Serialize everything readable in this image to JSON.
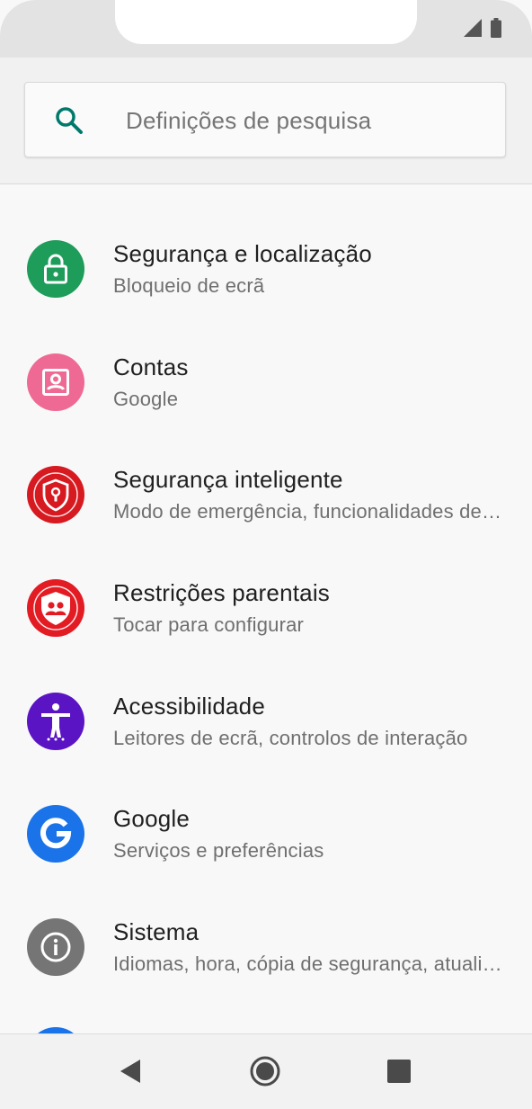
{
  "search": {
    "placeholder": "Definições de pesquisa"
  },
  "settings": [
    {
      "title": "Segurança e localização",
      "subtitle": "Bloqueio de ecrã",
      "icon": "lock-icon",
      "color": "#1e9c5a"
    },
    {
      "title": "Contas",
      "subtitle": "Google",
      "icon": "account-box-icon",
      "color": "#ee6a94"
    },
    {
      "title": "Segurança inteligente",
      "subtitle": "Modo de emergência, funcionalidades de segurança",
      "icon": "shield-keyhole-icon",
      "color": "#d71920"
    },
    {
      "title": "Restrições parentais",
      "subtitle": "Tocar para configurar",
      "icon": "parental-shield-icon",
      "color": "#e31b23"
    },
    {
      "title": "Acessibilidade",
      "subtitle": "Leitores de ecrã, controlos de interação",
      "icon": "accessibility-icon",
      "color": "#5b14c4"
    },
    {
      "title": "Google",
      "subtitle": "Serviços e preferências",
      "icon": "google-g-icon",
      "color": "#1a73e8"
    },
    {
      "title": "Sistema",
      "subtitle": "Idiomas, hora, cópia de segurança, atualizações",
      "icon": "info-icon",
      "color": "#757575"
    }
  ],
  "navbar": {
    "icons": [
      "back-icon",
      "home-icon",
      "recents-icon"
    ]
  }
}
